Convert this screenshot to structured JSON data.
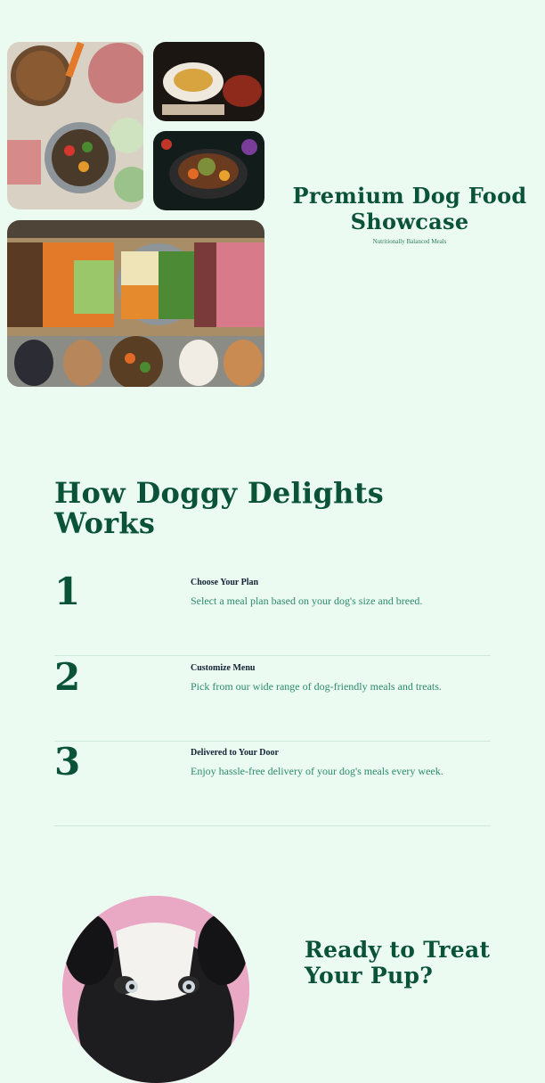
{
  "showcase": {
    "title": "Premium Dog Food Showcase",
    "subtitle": "Nutritionally Balanced Meals"
  },
  "how_it_works": {
    "title": "How Doggy Delights Works",
    "steps": [
      {
        "number": "1",
        "title": "Choose Your Plan",
        "description": "Select a meal plan based on your dog's size and breed."
      },
      {
        "number": "2",
        "title": "Customize Menu",
        "description": "Pick from our wide range of dog-friendly meals and treats."
      },
      {
        "number": "3",
        "title": "Delivered to Your Door",
        "description": "Enjoy hassle-free delivery of your dog's meals every week."
      }
    ]
  },
  "cta": {
    "title": "Ready to Treat Your Pup?"
  }
}
